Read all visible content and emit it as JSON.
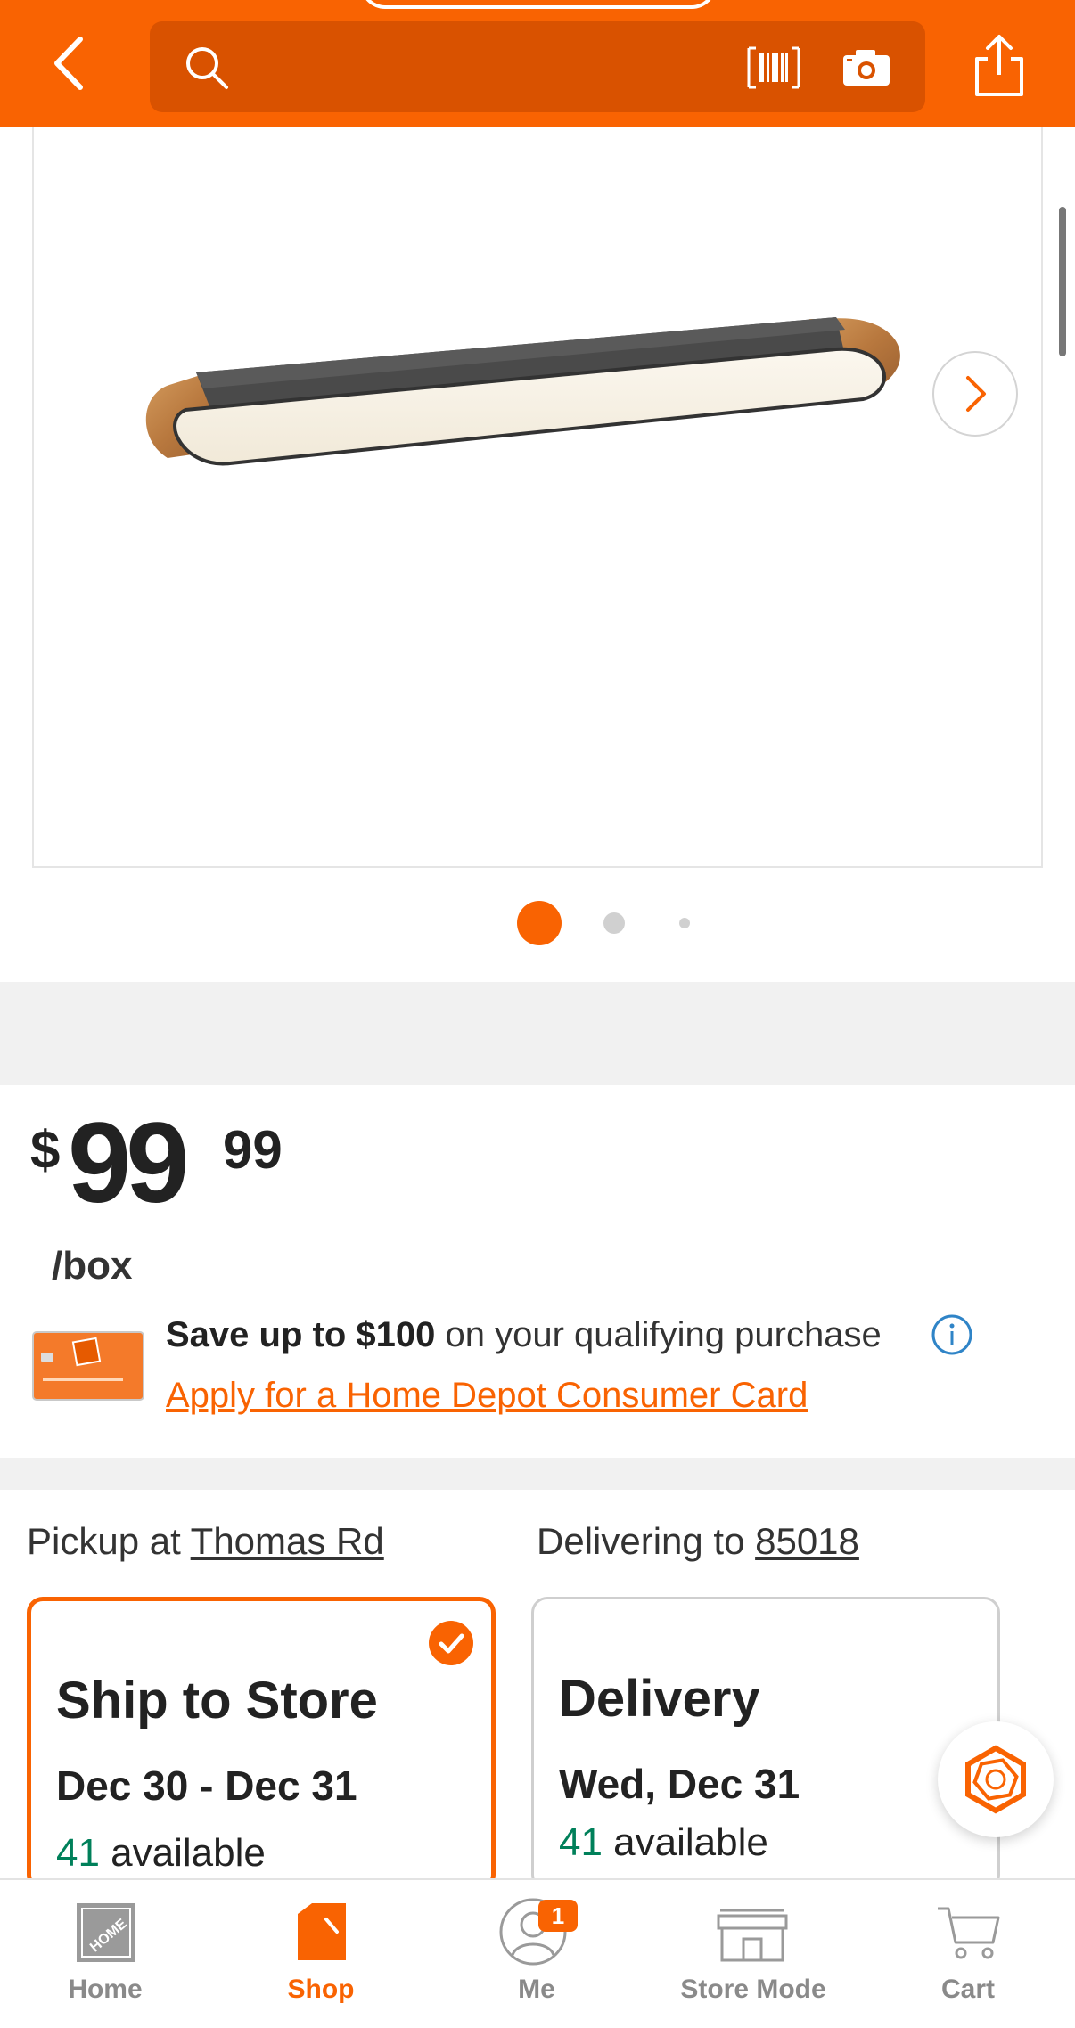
{
  "header": {
    "search_placeholder": "",
    "accent_color": "#f96302",
    "icons": [
      "back-icon",
      "search-icon",
      "barcode-icon",
      "camera-icon",
      "share-icon"
    ]
  },
  "gallery": {
    "image_alt": "Oval LED flush mount ceiling light with dark gray body and wood grain ends",
    "page_count": 3,
    "active_page": 1
  },
  "price": {
    "currency": "$",
    "dollars": "99",
    "cents": "99",
    "unit": "/box"
  },
  "promo": {
    "bold": "Save up to $100",
    "text": " on your qualifying purchase",
    "link": "Apply for a Home Depot Consumer Card"
  },
  "fulfillment": {
    "pickup_prefix": "Pickup at ",
    "pickup_store": "Thomas Rd",
    "delivery_prefix": "Delivering to ",
    "delivery_zip": "85018",
    "options": [
      {
        "title": "Ship to Store",
        "date": "Dec 30 - Dec 31",
        "available_count": "41",
        "available_text": " available",
        "selected": true
      },
      {
        "title": "Delivery",
        "date": "Wed, Dec 31",
        "available_count": "41",
        "available_text": " available",
        "selected": false
      }
    ]
  },
  "tabbar": {
    "items": [
      {
        "label": "Home"
      },
      {
        "label": "Shop"
      },
      {
        "label": "Me",
        "badge": "1"
      },
      {
        "label": "Store Mode"
      },
      {
        "label": "Cart"
      }
    ],
    "active": "Shop"
  }
}
